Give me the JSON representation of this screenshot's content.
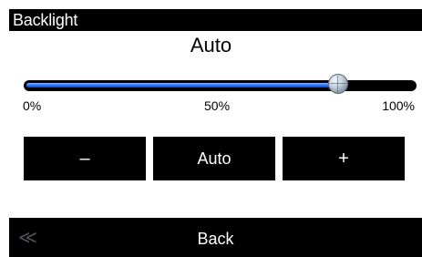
{
  "header": {
    "title": "Backlight"
  },
  "mode": {
    "current": "Auto"
  },
  "slider": {
    "level_percent": 80,
    "ticks": [
      "0%",
      "50%",
      "100%"
    ],
    "fill_color": "#2a76ff"
  },
  "buttons": {
    "decrease_label": "–",
    "auto_label": "Auto",
    "increase_label": "+"
  },
  "footer": {
    "back_icon": "double-chevron-left-icon",
    "back_glyph": "≪",
    "back_label": "Back"
  }
}
